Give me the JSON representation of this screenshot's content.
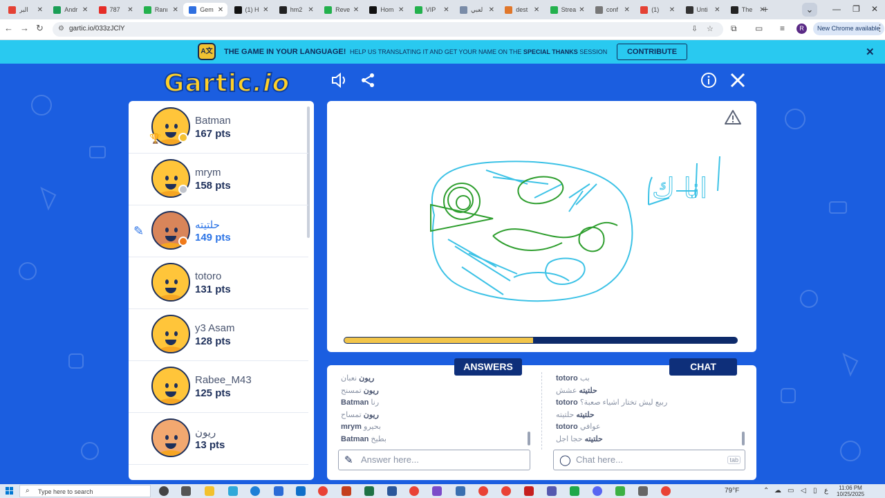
{
  "browser": {
    "tabs": [
      {
        "label": "البر",
        "favicon": "gmail-icon",
        "color": "#e44134"
      },
      {
        "label": "Andr",
        "favicon": "sheets-icon",
        "color": "#1a9e56"
      },
      {
        "label": "787",
        "favicon": "youtube-icon",
        "color": "#e52d27"
      },
      {
        "label": "Ranı",
        "favicon": "k-icon",
        "color": "#23b14d"
      },
      {
        "label": "Gem",
        "favicon": "gartic-icon",
        "color": "#2f6fe0",
        "active": true
      },
      {
        "label": "(1) H",
        "favicon": "x-icon",
        "color": "#111111"
      },
      {
        "label": "hm2",
        "favicon": "github-icon",
        "color": "#222222"
      },
      {
        "label": "Reve",
        "favicon": "k-icon",
        "color": "#23b14d"
      },
      {
        "label": "Hom",
        "favicon": "x-icon",
        "color": "#111111"
      },
      {
        "label": "VIP",
        "favicon": "k-icon",
        "color": "#23b14d"
      },
      {
        "label": "لعبي",
        "favicon": "site-icon",
        "color": "#7a8ca8"
      },
      {
        "label": "dest",
        "favicon": "site-icon",
        "color": "#e0772b"
      },
      {
        "label": "Strea",
        "favicon": "k-icon",
        "color": "#23b14d"
      },
      {
        "label": "conf",
        "favicon": "globe-icon",
        "color": "#777777"
      },
      {
        "label": "(1)",
        "favicon": "site-icon",
        "color": "#e44134"
      },
      {
        "label": "Unti",
        "favicon": "site-icon",
        "color": "#333333"
      },
      {
        "label": "The",
        "favicon": "github-icon",
        "color": "#222222"
      }
    ],
    "new_tab": "+",
    "window_controls": [
      "—",
      "❐",
      "✕"
    ],
    "url": "gartic.io/033zJClY",
    "update_button": "New Chrome available",
    "profile_initial": "R"
  },
  "banner": {
    "title": "THE GAME IN YOUR LANGUAGE!",
    "text_prefix": "HELP US TRANSLATING IT AND GET YOUR NAME ON THE",
    "text_highlight": "SPECIAL THANKS",
    "text_suffix": "SESSION",
    "button": "CONTRIBUTE",
    "close": "✕"
  },
  "game": {
    "logo": "Gartic",
    "logo_suffix": ".io",
    "players": [
      {
        "name": "Batman",
        "points": "167 pts",
        "status_color": "#f4c030",
        "avatar_color": "#ffc53a",
        "leader": true
      },
      {
        "name": "mrym",
        "points": "158 pts",
        "status_color": "#c0c4cc",
        "avatar_color": "#ffc53a"
      },
      {
        "name": "حلتيته",
        "points": "149 pts",
        "status_color": "#f07a1a",
        "avatar_color": "#d9855a",
        "drawing": true
      },
      {
        "name": "totoro",
        "points": "131 pts",
        "status_color": "",
        "avatar_color": "#ffc53a"
      },
      {
        "name": "y3 Asam",
        "points": "128 pts",
        "status_color": "",
        "avatar_color": "#ffc53a"
      },
      {
        "name": "Rabee_M43",
        "points": "125 pts",
        "status_color": "",
        "avatar_color": "#ffc53a"
      },
      {
        "name": "ريون",
        "points": "13 pts",
        "status_color": "",
        "avatar_color": "#f2a870"
      }
    ],
    "canvas_text": "انا ك",
    "timer_progress": 0.48,
    "answers_header": "ANSWERS",
    "chat_header": "CHAT",
    "answers": [
      {
        "user": "ريون",
        "text": "نعبان"
      },
      {
        "user": "ريون",
        "text": "تمسنح"
      },
      {
        "user": "Batman",
        "text": "رنا"
      },
      {
        "user": "ريون",
        "text": "تمساح"
      },
      {
        "user": "mrym",
        "text": "بحيرو"
      },
      {
        "user": "Batman",
        "text": "بطيخ"
      }
    ],
    "chat": [
      {
        "user": "totoro",
        "text": "بب"
      },
      {
        "user": "حلتيته",
        "text": "عشش"
      },
      {
        "user": "totoro",
        "text": "ربيع ليش تختار اشياء صعبة؟"
      },
      {
        "user": "حلتيته",
        "text": "حلتيته"
      },
      {
        "user": "totoro",
        "text": "عوافي"
      },
      {
        "user": "حلتيته",
        "text": "حجا اجل"
      }
    ],
    "answer_placeholder": "Answer here...",
    "chat_placeholder": "Chat here...",
    "tab_key": "tab"
  },
  "taskbar": {
    "search_placeholder": "Type here to search",
    "weather": "79°F",
    "time": "11:06 PM",
    "date": "10/25/2025",
    "lang": "ع"
  }
}
